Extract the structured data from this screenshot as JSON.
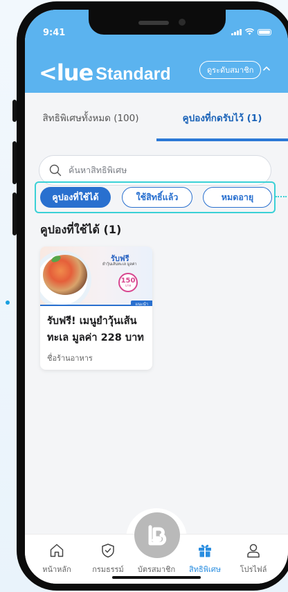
{
  "status_bar": {
    "time": "9:41"
  },
  "header": {
    "brand_mark": "<lue",
    "brand_name": "Standard",
    "tier_button": "ดูระดับสมาชิก"
  },
  "tabs": [
    {
      "label": "สิทธิพิเศษทั้งหมด (100)",
      "active": false
    },
    {
      "label": "คูปองที่กดรับไว้ (1)",
      "active": true
    }
  ],
  "search": {
    "placeholder": "ค้นหาสิทธิพิเศษ"
  },
  "filters": [
    {
      "label": "คูปองที่ใช้ได้",
      "active": true
    },
    {
      "label": "ใช้สิทธิ์แล้ว",
      "active": false
    },
    {
      "label": "หมดอายุ",
      "active": false
    }
  ],
  "section": {
    "title": "คูปองที่ใช้ได้ (1)"
  },
  "coupons": [
    {
      "image_headline": "รับฟรี",
      "image_sub": "ยำวุ้นเส้นทะเล มูลค่า",
      "image_price": "150",
      "image_price_unit": "บาท",
      "badge": "แนะนำ",
      "title": "รับฟรี! เมนูยำวุ้นเส้นทะเล มูลค่า 228 บาท",
      "shop": "ชื่อร้านอาหาร"
    }
  ],
  "bottom_nav": [
    {
      "label": "หน้าหลัก",
      "icon": "home-icon",
      "active": false
    },
    {
      "label": "กรมธรรม์",
      "icon": "shield-check-icon",
      "active": false
    },
    {
      "label": "บัตรสมาชิก",
      "icon": "member-card-icon",
      "active": false
    },
    {
      "label": "สิทธิพิเศษ",
      "icon": "gift-icon",
      "active": true
    },
    {
      "label": "โปรไฟล์",
      "icon": "user-icon",
      "active": false
    }
  ],
  "colors": {
    "header_blue": "#5bb3ef",
    "primary": "#2970cf",
    "active_tab": "#1b63b8",
    "highlight_outline": "#3ad1d6",
    "nav_active": "#2b8ee0"
  }
}
